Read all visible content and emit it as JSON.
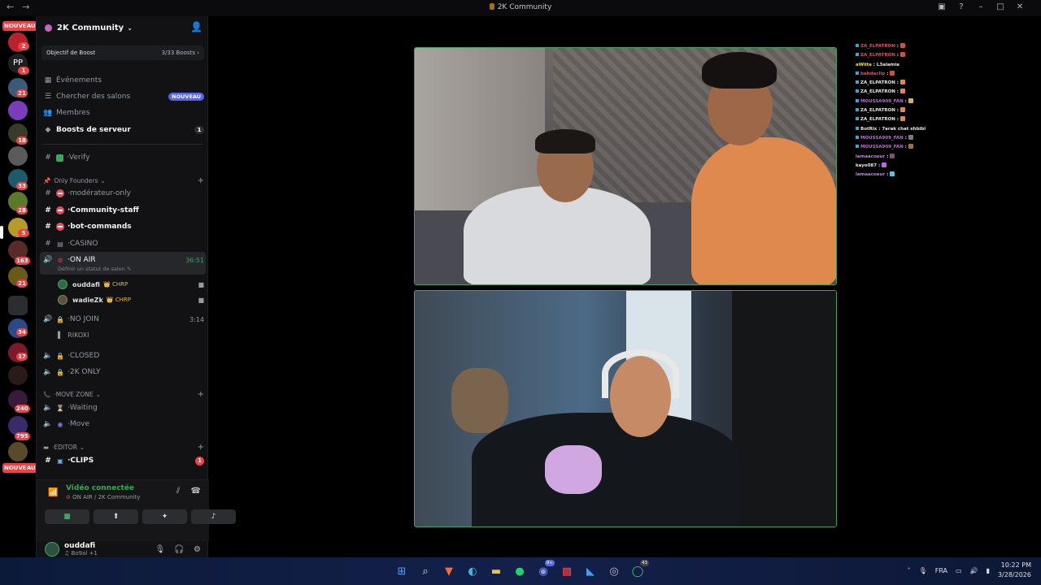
{
  "window": {
    "title": "2K Community"
  },
  "rail": {
    "nouveau_top": "NOUVEAU",
    "nouveau_bottom": "NOUVEAU",
    "pp_label": "PP",
    "badges": [
      "2",
      "1",
      "21",
      "18",
      "33",
      "28",
      "5",
      "163",
      "21",
      "34",
      "17",
      "240",
      "795"
    ]
  },
  "server": {
    "name": "2K Community",
    "boost_goal_label": "Objectif de Boost",
    "boost_count": "3/33 Boosts"
  },
  "menu": {
    "events": "Événements",
    "search_channels": "Chercher des salons",
    "search_badge": "NOUVEAU",
    "members": "Membres",
    "server_boosts": "Boosts de serveur",
    "server_boosts_badge": "1"
  },
  "channels": {
    "verify": "Verify",
    "cat_founders": "Only Founders",
    "moderateur": "modérateur-only",
    "community_staff": "Community-staff",
    "bot_commands": "bot-commands",
    "casino": "CASINO",
    "on_air": "ON AIR",
    "on_air_timer": "36:51",
    "on_air_status": "Définir un statut de salon",
    "user1_name": "ouddafi",
    "user1_tag": "CHRP",
    "user2_name": "wadieZk",
    "user2_tag": "CHRP",
    "no_join": "NO JOIN",
    "no_join_timer": "3:14",
    "rikoxi": "RIKOXI",
    "closed": "CLOSED",
    "two_k_only": "2K ONLY",
    "cat_move": "MOVE ZONE",
    "waiting": "Waiting",
    "move": "Move",
    "cat_editor": "EDITOR",
    "clips": "CLIPS",
    "clips_badge": "1"
  },
  "voice_panel": {
    "title": "Vidéo connectée",
    "subtitle": "ON AIR / 2K Community"
  },
  "user_bar": {
    "name": "ouddafi",
    "status": "Bo9al +1"
  },
  "chat": [
    {
      "user": "ZA_ELPATRON",
      "msg": ""
    },
    {
      "user": "ZA_ELPATRON",
      "msg": ""
    },
    {
      "user": "aWiita",
      "msg": "L3alamia"
    },
    {
      "user": "bahdaclip",
      "msg": ""
    },
    {
      "user": "ZA_ELPATRON",
      "msg": ""
    },
    {
      "user": "ZA_ELPATRON",
      "msg": ""
    },
    {
      "user": "MOUSSA909_FAN",
      "msg": ""
    },
    {
      "user": "ZA_ELPATRON",
      "msg": ""
    },
    {
      "user": "ZA_ELPATRON",
      "msg": ""
    },
    {
      "user": "BotRix",
      "msg": "7arak chat shbibi"
    },
    {
      "user": "MOUSSA909_FAN",
      "msg": ""
    },
    {
      "user": "MOUSSA909_FAN",
      "msg": ""
    },
    {
      "user": "lamaacoeur",
      "msg": ""
    },
    {
      "user": "kayo087",
      "msg": ""
    },
    {
      "user": "lamaacoeur",
      "msg": ""
    }
  ],
  "taskbar": {
    "discord_badge": "9+",
    "whatsapp_badge": "43",
    "lang": "FRA",
    "time": "10:22 PM",
    "date": "3/28/2026"
  }
}
